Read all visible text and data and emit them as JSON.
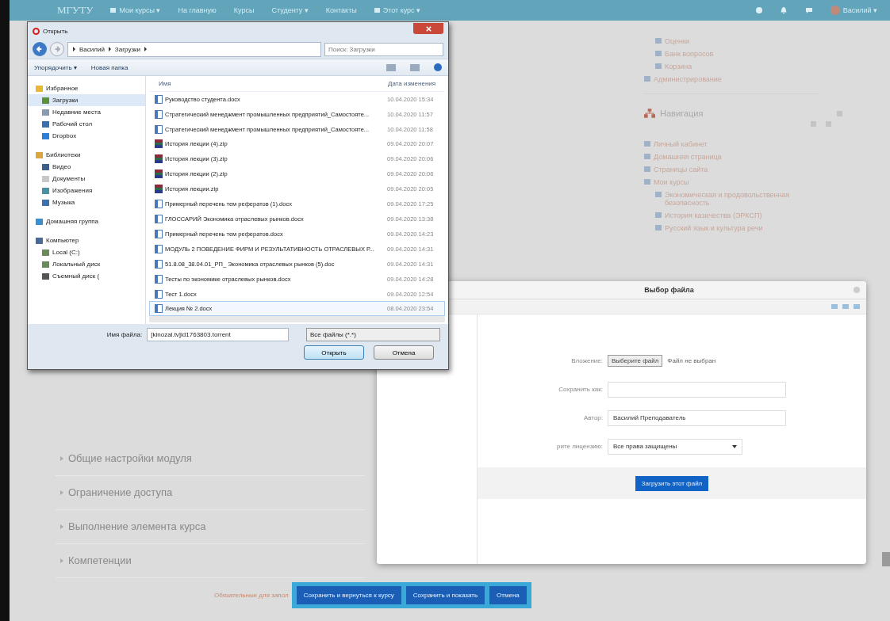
{
  "navbar": {
    "brand": "МГУТУ",
    "items": [
      {
        "label": "Мои курсы ▾",
        "icon": true
      },
      {
        "label": "На главную",
        "icon": false
      },
      {
        "label": "Курсы",
        "icon": false
      },
      {
        "label": "Студенту ▾",
        "icon": false
      },
      {
        "label": "Контакты",
        "icon": false
      },
      {
        "label": "Этот курс ▾",
        "icon": true
      }
    ],
    "user": "Василий ▾"
  },
  "sidebar": {
    "admin_items": [
      {
        "label": "Оценки"
      },
      {
        "label": "Банк вопросов"
      },
      {
        "label": "Корзина"
      }
    ],
    "admin_title": "Администрирование",
    "nav_title": "Навигация",
    "nav_items": [
      {
        "label": "Личный кабинет"
      },
      {
        "label": "Домашняя страница"
      },
      {
        "label": "Страницы сайта"
      },
      {
        "label": "Мои курсы",
        "children": [
          {
            "label": "Экономическая и продовольственная безопасность"
          },
          {
            "label": "История казачества (ЭРКСП)"
          },
          {
            "label": "Русский язык и культура речи"
          }
        ]
      }
    ]
  },
  "sections": [
    "Общие настройки модуля",
    "Ограничение доступа",
    "Выполнение элемента курса",
    "Компетенции"
  ],
  "required_note": "Обязательные для запол",
  "form_buttons": [
    "Сохранить и вернуться к курсу",
    "Сохранить и показать",
    "Отмена"
  ],
  "file_picker": {
    "title": "Выбор файла",
    "rows": [
      {
        "kind": "file",
        "label": "Вложение:",
        "button": "Выберите файл",
        "value": "Файл не выбран"
      },
      {
        "kind": "text",
        "label": "Сохранить как:",
        "value": ""
      },
      {
        "kind": "text",
        "label": "Автор:",
        "value": "Василий Преподаватель"
      },
      {
        "kind": "select",
        "label": "рите лицензию:",
        "value": "Все права защищены"
      }
    ],
    "upload_button": "Загрузить этот файл"
  },
  "open_dialog": {
    "title": "Открыть",
    "path": [
      "Василий",
      "Загрузки"
    ],
    "search_placeholder": "Поиск: Загрузки",
    "toolbar": [
      "Упорядочить ▾",
      "Новая папка"
    ],
    "nav": [
      {
        "label": "Избранное",
        "kind": "star",
        "selected": false,
        "children": [
          {
            "label": "Загрузки",
            "kind": "download",
            "selected": true
          },
          {
            "label": "Недавние места",
            "kind": "recent",
            "selected": false
          },
          {
            "label": "Рабочий стол",
            "kind": "desktop",
            "selected": false
          },
          {
            "label": "Dropbox",
            "kind": "dropbox",
            "selected": false
          }
        ]
      },
      {
        "label": "Библиотеки",
        "kind": "library",
        "selected": false,
        "children": [
          {
            "label": "Видео",
            "kind": "video",
            "selected": false
          },
          {
            "label": "Документы",
            "kind": "docs",
            "selected": false
          },
          {
            "label": "Изображения",
            "kind": "pictures",
            "selected": false
          },
          {
            "label": "Музыка",
            "kind": "music",
            "selected": false
          }
        ]
      },
      {
        "label": "Домашняя группа",
        "kind": "homegroup",
        "selected": false
      },
      {
        "label": "Компьютер",
        "kind": "computer",
        "selected": false,
        "children": [
          {
            "label": "Local (C:)",
            "kind": "drive",
            "selected": false
          },
          {
            "label": "Локальный диск",
            "kind": "drive",
            "selected": false
          },
          {
            "label": "Съемный диск (",
            "kind": "removable",
            "selected": false
          }
        ]
      }
    ],
    "columns": [
      "Имя",
      "Дата изменения"
    ],
    "files": [
      {
        "name": "Руководство студента.docx",
        "date": "10.04.2020 15:34",
        "kind": "doc",
        "selected": false
      },
      {
        "name": "Стратегический менеджмент промышленных предприятий_Самостояте...",
        "date": "10.04.2020 11:57",
        "kind": "doc",
        "selected": false
      },
      {
        "name": "Стратегический менеджмент промышленных предприятий_Самостояте...",
        "date": "10.04.2020 11:58",
        "kind": "doc",
        "selected": false
      },
      {
        "name": "История лекции (4).zip",
        "date": "09.04.2020 20:07",
        "kind": "zip",
        "selected": false
      },
      {
        "name": "История лекции (3).zip",
        "date": "09.04.2020 20:06",
        "kind": "zip",
        "selected": false
      },
      {
        "name": "История лекции (2).zip",
        "date": "09.04.2020 20:06",
        "kind": "zip",
        "selected": false
      },
      {
        "name": "История лекции.zip",
        "date": "09.04.2020 20:05",
        "kind": "zip",
        "selected": false
      },
      {
        "name": "Примерный перечень тем рефератов (1).docx",
        "date": "09.04.2020 17:25",
        "kind": "doc",
        "selected": false
      },
      {
        "name": "ГЛОССАРИЙ Экономика отраслевых рынков.docx",
        "date": "09.04.2020 13:38",
        "kind": "doc",
        "selected": false
      },
      {
        "name": "Примерный перечень тем рефератов.docx",
        "date": "09.04.2020 14:23",
        "kind": "doc",
        "selected": false
      },
      {
        "name": "МОДУЛЬ 2 ПОВЕДЕНИЕ ФИРМ И РЕЗУЛЬТАТИВНОСТЬ ОТРАСЛЕВЫХ Р...",
        "date": "09.04.2020 14:31",
        "kind": "doc",
        "selected": false
      },
      {
        "name": "51.8.08_38.04.01_РП_ Экономика отраслевых рынков (5).doc",
        "date": "09.04.2020 14:31",
        "kind": "doc",
        "selected": false
      },
      {
        "name": "Тесты по экономике отраслевых рынков.docx",
        "date": "09.04.2020 14:28",
        "kind": "doc",
        "selected": false
      },
      {
        "name": "Тест 1.docx",
        "date": "09.04.2020 12:54",
        "kind": "doc",
        "selected": false
      },
      {
        "name": "Лекция № 2.docx",
        "date": "08.04.2020 23:54",
        "kind": "doc",
        "selected": true
      }
    ],
    "filename_label": "Имя файла:",
    "filename": "[kinozal.tv]id1763803.torrent",
    "filter": "Все файлы (*.*)",
    "buttons": [
      "Открыть",
      "Отмена"
    ]
  }
}
